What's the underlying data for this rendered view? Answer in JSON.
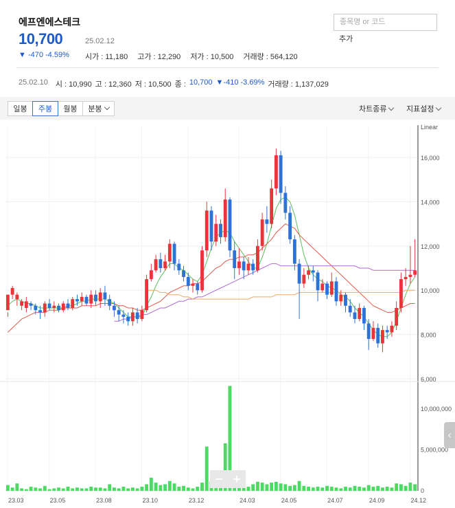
{
  "stock": {
    "name": "에프엔에스테크",
    "price": "10,700",
    "date": "25.02.12",
    "change": "▼ -470 -4.59%",
    "open_label": "시가 : 11,180",
    "high_label": "고가 : 12,290",
    "low_label": "저가 : 10,500",
    "volume_label": "거래량 : 564,120"
  },
  "search": {
    "placeholder": "종목명 or 코드",
    "add_label": "추가"
  },
  "prev": {
    "date": "25.02.10",
    "open": "시 : 10,990",
    "high": "고 : 12,360",
    "low": "저 : 10,500",
    "close_label": "종 :",
    "close_value": "10,700",
    "change": "▼-410 -3.69%",
    "volume": "거래량 : 1,137,029"
  },
  "toolbar": {
    "tabs": [
      "일봉",
      "주봉",
      "월봉",
      "분봉"
    ],
    "active_tab": "주봉",
    "chart_type": "차트종류",
    "indicator": "지표설정"
  },
  "colors": {
    "up": "#e8343a",
    "down": "#2f72d6",
    "volume": "#4cd964",
    "ma5": "#5cbf5c",
    "ma20": "#e05b4b",
    "ma60": "#b066d6",
    "ma120": "#f0a860",
    "accent": "#1f5bc6"
  },
  "chart_data": {
    "type": "candlestick",
    "scale": "Linear",
    "y_ticks": [
      "16,000",
      "14,000",
      "12,000",
      "10,000",
      "8,000",
      "6,000"
    ],
    "y_range": [
      6000,
      17400
    ],
    "volume_ticks": [
      "10,000,000",
      "5,000,000",
      "0"
    ],
    "volume_range": [
      0,
      13000000
    ],
    "x_ticks": [
      "23.03",
      "23.05",
      "23.08",
      "23.10",
      "23.12",
      "24.03",
      "24.05",
      "24.07",
      "24.09",
      "24.12"
    ],
    "candles": [
      [
        9100,
        9800,
        9000,
        8800
      ],
      [
        9800,
        10100,
        9600,
        10200
      ],
      [
        9600,
        9800,
        9300,
        9900
      ],
      [
        9300,
        9500,
        9100,
        9600
      ],
      [
        9200,
        9500,
        9000,
        9700
      ],
      [
        9400,
        9300,
        9100,
        9500
      ],
      [
        9300,
        9100,
        8900,
        9400
      ],
      [
        9100,
        9000,
        8700,
        9300
      ],
      [
        9000,
        9400,
        8800,
        9500
      ],
      [
        9400,
        9200,
        9100,
        9600
      ],
      [
        9200,
        9300,
        9000,
        9500
      ],
      [
        9300,
        9100,
        9000,
        9400
      ],
      [
        9100,
        9400,
        9000,
        9500
      ],
      [
        9400,
        9200,
        9100,
        9600
      ],
      [
        9200,
        9600,
        9100,
        9700
      ],
      [
        9600,
        9500,
        9300,
        9800
      ],
      [
        9500,
        9700,
        9300,
        9900
      ],
      [
        9700,
        9400,
        9300,
        9800
      ],
      [
        9400,
        9800,
        9200,
        10000
      ],
      [
        9800,
        9500,
        9300,
        10000
      ],
      [
        9500,
        9900,
        9200,
        10100
      ],
      [
        9900,
        9600,
        9300,
        10200
      ],
      [
        9600,
        9300,
        9100,
        9800
      ],
      [
        9300,
        9100,
        8800,
        9500
      ],
      [
        9100,
        8900,
        8600,
        9300
      ],
      [
        8900,
        8800,
        8500,
        9100
      ],
      [
        8800,
        8600,
        8400,
        9000
      ],
      [
        8600,
        9000,
        8400,
        9200
      ],
      [
        9000,
        8700,
        8500,
        9200
      ],
      [
        8700,
        9100,
        8600,
        9300
      ],
      [
        9100,
        10500,
        9000,
        10700
      ],
      [
        10500,
        10900,
        10400,
        11200
      ],
      [
        10900,
        11400,
        10800,
        11600
      ],
      [
        11400,
        11000,
        10800,
        11700
      ],
      [
        11000,
        11300,
        10900,
        11600
      ],
      [
        11300,
        12100,
        11000,
        12300
      ],
      [
        12100,
        11200,
        10900,
        12200
      ],
      [
        11200,
        10900,
        10700,
        11400
      ],
      [
        10900,
        10600,
        10400,
        11100
      ],
      [
        10600,
        10200,
        10000,
        10800
      ],
      [
        10200,
        10300,
        9900,
        10500
      ],
      [
        10300,
        10000,
        9800,
        10400
      ],
      [
        10000,
        11800,
        9900,
        12000
      ],
      [
        11800,
        13600,
        11500,
        14000
      ],
      [
        13600,
        12200,
        11800,
        13800
      ],
      [
        12200,
        13000,
        12000,
        13400
      ],
      [
        13000,
        12400,
        12100,
        13200
      ],
      [
        12400,
        14100,
        12200,
        14600
      ],
      [
        14100,
        11800,
        11500,
        14200
      ],
      [
        11800,
        11000,
        10500,
        12200
      ],
      [
        11000,
        11300,
        10700,
        11900
      ],
      [
        11300,
        10900,
        10500,
        11500
      ],
      [
        10900,
        11200,
        10700,
        11500
      ],
      [
        11200,
        10900,
        10700,
        11400
      ],
      [
        10900,
        12000,
        10800,
        12300
      ],
      [
        12000,
        13200,
        11800,
        13500
      ],
      [
        13200,
        13000,
        12600,
        13800
      ],
      [
        13000,
        14600,
        12800,
        15000
      ],
      [
        14600,
        16100,
        14300,
        16400
      ],
      [
        16100,
        14400,
        13900,
        16300
      ],
      [
        14400,
        13500,
        13200,
        14700
      ],
      [
        13500,
        12300,
        12100,
        13800
      ],
      [
        12300,
        11200,
        10900,
        12500
      ],
      [
        11200,
        10300,
        8700,
        11400
      ],
      [
        10300,
        10700,
        10100,
        11000
      ],
      [
        10700,
        10900,
        10500,
        11100
      ],
      [
        10900,
        10800,
        10400,
        11100
      ],
      [
        10800,
        10000,
        9500,
        10900
      ],
      [
        10000,
        10300,
        9900,
        10500
      ],
      [
        10300,
        9800,
        9600,
        10400
      ],
      [
        9800,
        10400,
        9700,
        10800
      ],
      [
        10400,
        9500,
        9300,
        10600
      ],
      [
        9500,
        9800,
        9300,
        10000
      ],
      [
        9800,
        9300,
        9000,
        9900
      ],
      [
        9300,
        9000,
        8800,
        9600
      ],
      [
        9000,
        8700,
        8500,
        9300
      ],
      [
        8700,
        9200,
        8600,
        9400
      ],
      [
        9200,
        8500,
        8200,
        9300
      ],
      [
        8500,
        7800,
        7300,
        8700
      ],
      [
        7800,
        8300,
        7700,
        8600
      ],
      [
        8300,
        7600,
        7400,
        8500
      ],
      [
        7600,
        8200,
        7200,
        8400
      ],
      [
        8200,
        8100,
        7800,
        8400
      ],
      [
        8100,
        8400,
        7900,
        8600
      ],
      [
        8400,
        9200,
        8200,
        9500
      ],
      [
        9200,
        10500,
        9000,
        10800
      ],
      [
        10500,
        10600,
        10200,
        11000
      ],
      [
        10600,
        10700,
        10300,
        12000
      ],
      [
        10700,
        10900,
        10600,
        12300
      ]
    ],
    "volumes": [
      700000,
      400000,
      900000,
      300000,
      200000,
      500000,
      400000,
      300000,
      600000,
      200000,
      300000,
      400000,
      300000,
      500000,
      300000,
      400000,
      300000,
      300000,
      500000,
      400000,
      400000,
      300000,
      800000,
      400000,
      300000,
      500000,
      300000,
      400000,
      300000,
      500000,
      800000,
      1600000,
      1000000,
      700000,
      800000,
      1200000,
      900000,
      500000,
      600000,
      400000,
      300000,
      500000,
      1000000,
      5400000,
      1200000,
      900000,
      700000,
      5800000,
      12800000,
      1500000,
      600000,
      400000,
      500000,
      800000,
      1100000,
      1000000,
      800000,
      1000000,
      1100000,
      900000,
      800000,
      600000,
      700000,
      1200000,
      600000,
      500000,
      400000,
      500000,
      400000,
      600000,
      500000,
      400000,
      300000,
      500000,
      400000,
      600000,
      500000,
      400000,
      700000,
      500000,
      600000,
      400000,
      500000,
      400000,
      900000,
      800000,
      600000,
      1000000,
      800000
    ],
    "ma_lines": [
      {
        "key": "ma5",
        "values": [
          9300,
          9500,
          9600,
          9500,
          9400,
          9400,
          9300,
          9200,
          9200,
          9200,
          9200,
          9200,
          9200,
          9300,
          9300,
          9400,
          9500,
          9500,
          9600,
          9600,
          9600,
          9600,
          9500,
          9400,
          9200,
          9000,
          8800,
          8800,
          8800,
          8800,
          9300,
          9700,
          10200,
          10600,
          10900,
          11200,
          11200,
          11000,
          10900,
          10700,
          10500,
          10400,
          10700,
          11300,
          11900,
          12400,
          12600,
          12700,
          12600,
          12200,
          11900,
          11600,
          11300,
          11000,
          11000,
          11500,
          12100,
          12900,
          13700,
          14100,
          14200,
          14000,
          13400,
          12500,
          11600,
          11000,
          10700,
          10500,
          10400,
          10200,
          10100,
          10000,
          9800,
          9700,
          9500,
          9200,
          9000,
          8800,
          8500,
          8200,
          8000,
          7900,
          7900,
          8100,
          8600,
          9200,
          9800,
          10300,
          10600
        ],
        "color_key": "ma5"
      },
      {
        "key": "ma20",
        "values": [
          8100,
          8300,
          8500,
          8700,
          8800,
          8900,
          9000,
          9000,
          9000,
          9100,
          9100,
          9100,
          9200,
          9200,
          9200,
          9200,
          9300,
          9300,
          9300,
          9300,
          9400,
          9400,
          9400,
          9400,
          9300,
          9300,
          9200,
          9200,
          9100,
          9100,
          9200,
          9300,
          9400,
          9500,
          9700,
          9900,
          10000,
          10100,
          10200,
          10200,
          10300,
          10300,
          10400,
          10600,
          10800,
          11000,
          11100,
          11300,
          11400,
          11400,
          11500,
          11500,
          11600,
          11600,
          11700,
          11900,
          12100,
          12300,
          12600,
          12800,
          13000,
          12900,
          12800,
          12500,
          12300,
          12100,
          11900,
          11700,
          11500,
          11300,
          11100,
          10900,
          10700,
          10500,
          10300,
          10100,
          9900,
          9700,
          9500,
          9300,
          9200,
          9100,
          9000,
          9000,
          9100,
          9200,
          9300,
          9400,
          9400
        ],
        "color_key": "ma20"
      },
      {
        "key": "ma60",
        "values": [
          null,
          null,
          null,
          null,
          null,
          null,
          null,
          null,
          null,
          null,
          null,
          null,
          null,
          null,
          null,
          null,
          null,
          null,
          null,
          null,
          null,
          null,
          null,
          8600,
          8600,
          8700,
          8700,
          8800,
          8800,
          8900,
          8900,
          9000,
          9100,
          9200,
          9200,
          9300,
          9400,
          9500,
          9500,
          9600,
          9600,
          9700,
          9700,
          9800,
          9900,
          10000,
          10100,
          10200,
          10300,
          10400,
          10500,
          10600,
          10700,
          10800,
          10900,
          11000,
          11100,
          11200,
          11200,
          11100,
          11100,
          11100,
          11100,
          11100,
          11100,
          11100,
          11100,
          11100,
          11100,
          11100,
          11100,
          11100,
          11100,
          11100,
          11100,
          11100,
          11000,
          11000,
          11000,
          10900,
          10900,
          10900,
          10900,
          10900,
          10900,
          10900,
          10900,
          10900,
          10900
        ],
        "color_key": "ma60"
      },
      {
        "key": "ma120",
        "values": [
          null,
          null,
          null,
          null,
          null,
          null,
          null,
          null,
          null,
          null,
          null,
          null,
          null,
          null,
          null,
          null,
          null,
          null,
          null,
          null,
          null,
          null,
          null,
          null,
          null,
          null,
          null,
          null,
          null,
          null,
          10000,
          10000,
          10000,
          9900,
          9900,
          9800,
          9800,
          9800,
          9700,
          9700,
          9600,
          9600,
          9600,
          9600,
          9600,
          9600,
          9600,
          9600,
          9600,
          9600,
          9600,
          9600,
          9600,
          9700,
          9700,
          9700,
          9700,
          9700,
          9800,
          9800,
          9800,
          9800,
          9800,
          9900,
          9900,
          9900,
          9900,
          9900,
          9900,
          9900,
          9900,
          9900,
          9900,
          9900,
          9900,
          9900,
          9900,
          9900,
          9900,
          9900,
          9900,
          9900,
          9900,
          9900,
          9900,
          9900,
          10000,
          10000,
          10000
        ],
        "color_key": "ma120"
      }
    ]
  }
}
